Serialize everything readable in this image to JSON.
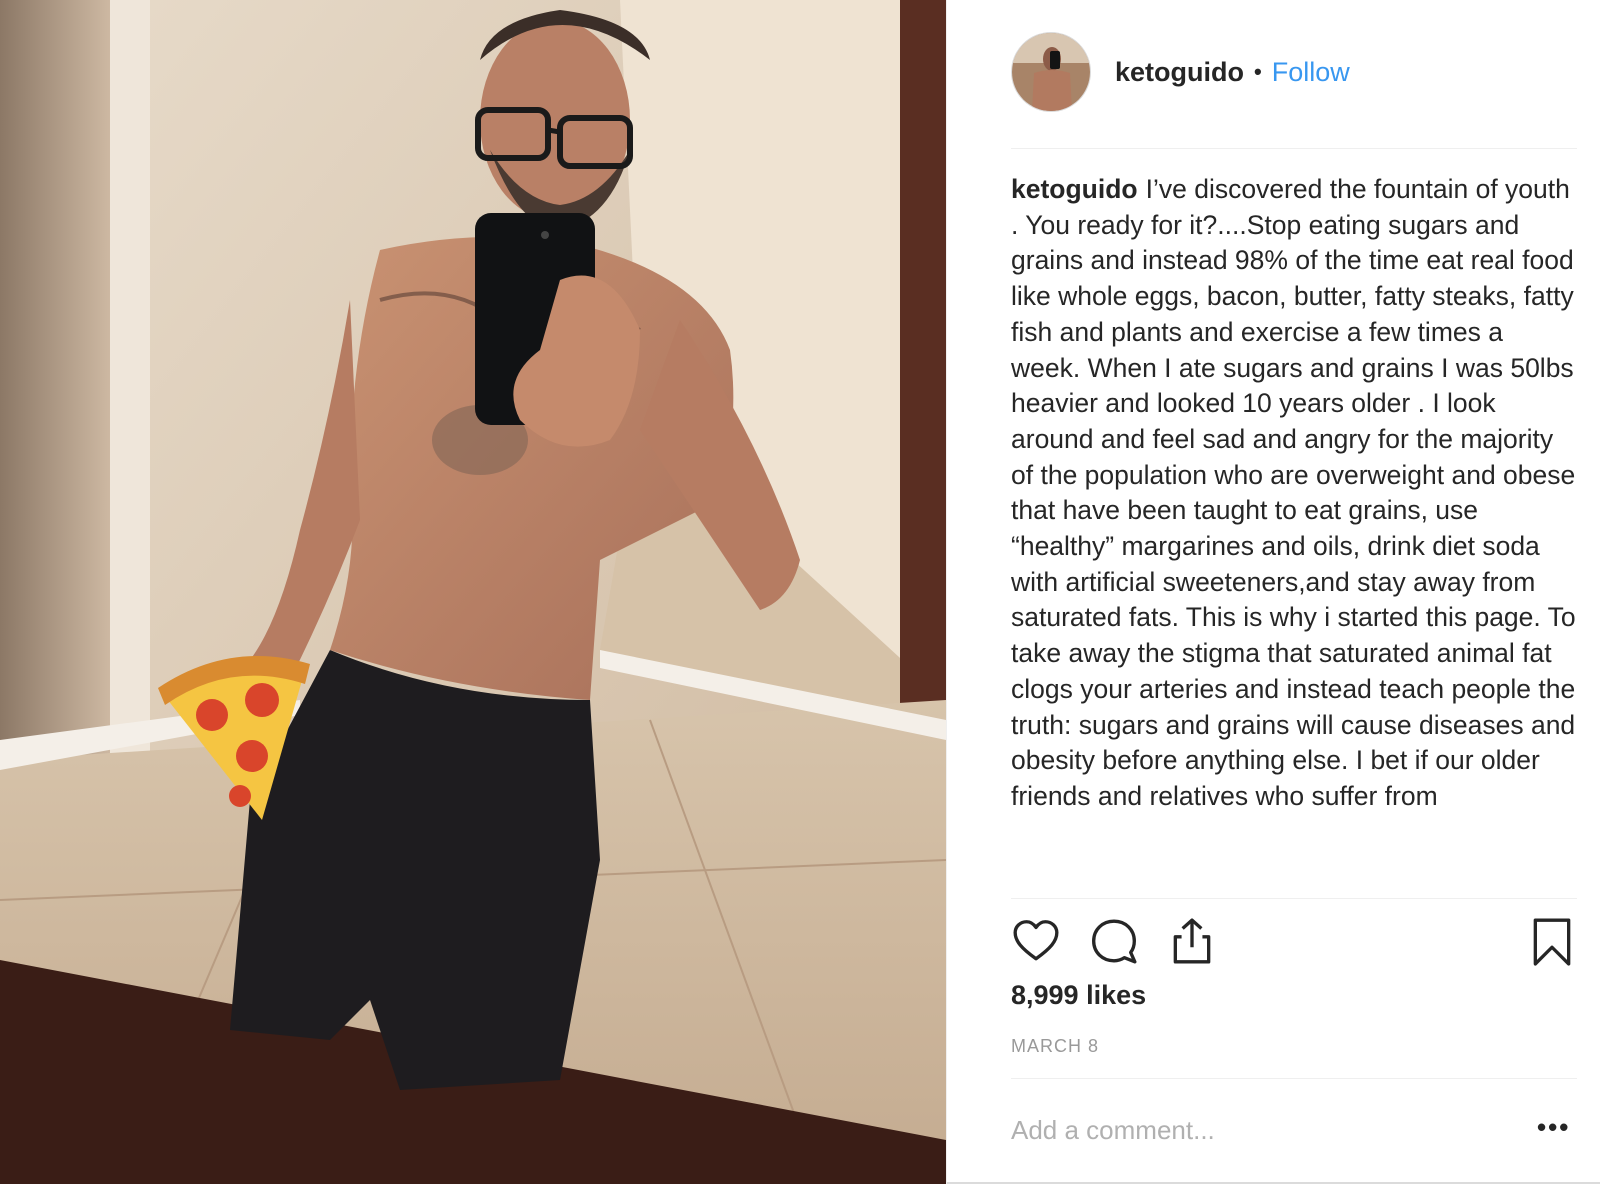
{
  "post": {
    "username": "ketoguido",
    "separator": "•",
    "follow_label": "Follow",
    "caption_user": "ketoguido",
    "caption_text": "I’ve discovered the fountain of youth . You ready for it?....Stop eating sugars and grains and instead 98% of the time eat real food like whole eggs, bacon, butter, fatty steaks, fatty fish and plants and exercise a few times a week. When I ate sugars and grains I was 50lbs heavier and looked 10 years older . I look around and feel sad and angry for the majority of the population who are overweight and obese that have been taught to eat grains, use “healthy” margarines and oils, drink diet soda with artificial sweeteners,and stay away from saturated fats. This is why i started this page. To take away the stigma that saturated animal fat clogs your arteries and instead teach people the truth: sugars and grains will cause diseases and obesity before anything else. I bet if our older friends and relatives who suffer from",
    "likes": "8,999 likes",
    "date": "MARCH 8",
    "comment_placeholder": "Add a comment...",
    "more_label": "•••"
  },
  "icons": {
    "avatar": "profile-avatar",
    "like": "heart-icon",
    "comment": "comment-bubble-icon",
    "share": "share-icon",
    "save": "bookmark-icon",
    "photo_sticker": "pizza-slice-emoji"
  },
  "colors": {
    "link_blue": "#3897f0",
    "text": "#262626",
    "muted": "#999999",
    "divider": "#efefef"
  }
}
